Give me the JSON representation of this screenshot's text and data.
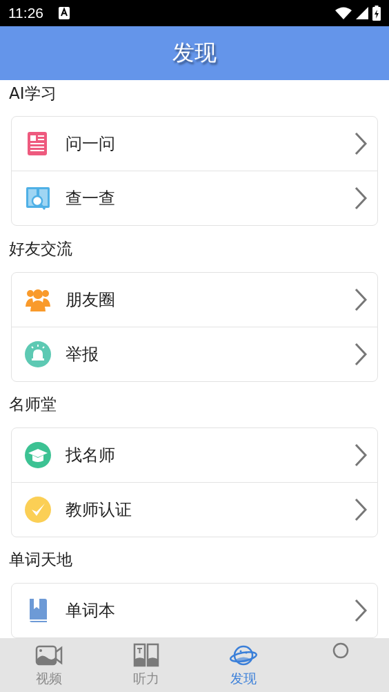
{
  "status_bar": {
    "time": "11:26"
  },
  "header": {
    "title": "发现"
  },
  "sections": [
    {
      "title": "AI学习",
      "items": [
        {
          "label": "问一问"
        },
        {
          "label": "查一查"
        }
      ]
    },
    {
      "title": "好友交流",
      "items": [
        {
          "label": "朋友圈"
        },
        {
          "label": "举报"
        }
      ]
    },
    {
      "title": "名师堂",
      "items": [
        {
          "label": "找名师"
        },
        {
          "label": "教师认证"
        }
      ]
    },
    {
      "title": "单词天地",
      "items": [
        {
          "label": "单词本"
        }
      ]
    }
  ],
  "bottom_nav": [
    {
      "label": "视频",
      "selected": false
    },
    {
      "label": "听力",
      "selected": false
    },
    {
      "label": "发现",
      "selected": true
    },
    {
      "selected": false
    }
  ]
}
